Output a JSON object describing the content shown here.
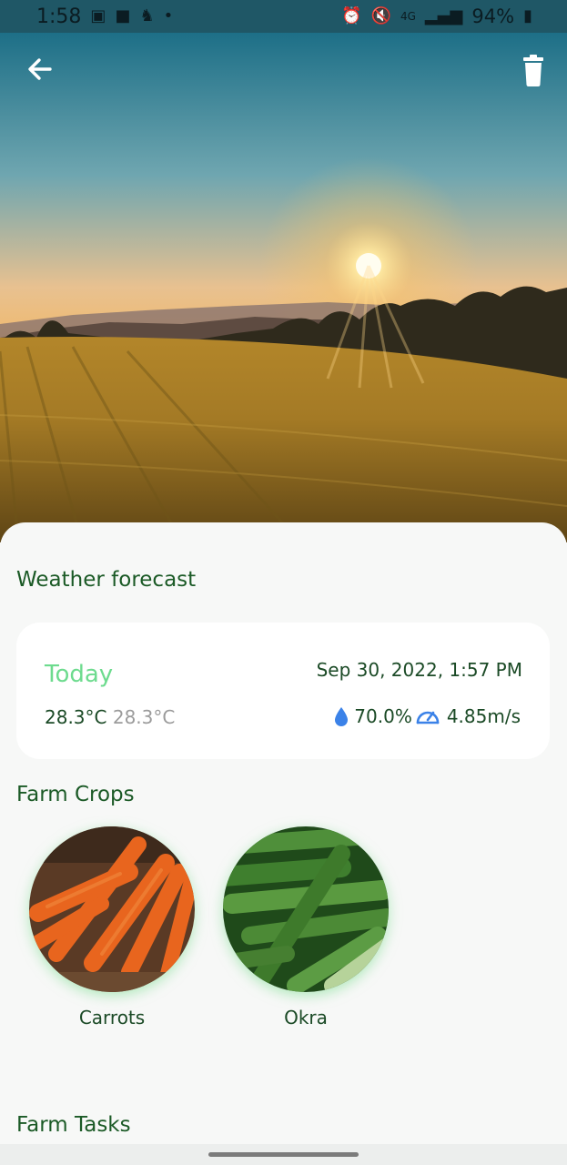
{
  "status_bar": {
    "time": "1:58",
    "left_icons": [
      "gallery-icon",
      "app-icon",
      "app-icon-2",
      "dot-icon"
    ],
    "right_icons": [
      "alarm-icon",
      "mute-icon",
      "network-4g-icon",
      "signal-icon"
    ],
    "battery": "94%"
  },
  "header": {
    "back_icon": "arrow-left-icon",
    "delete_icon": "trash-icon"
  },
  "weather": {
    "section_title": "Weather forecast",
    "day": "Today",
    "datetime": "Sep 30, 2022, 1:57 PM",
    "temp_high": "28.3°C",
    "temp_low": "28.3°C",
    "humidity": "70.0%",
    "wind": "4.85m/s",
    "humidity_icon": "water-drop-icon",
    "wind_icon": "speedometer-icon"
  },
  "crops": {
    "section_title": "Farm Crops",
    "items": [
      {
        "label": "Carrots"
      },
      {
        "label": "Okra"
      }
    ]
  },
  "tasks": {
    "section_title": "Farm Tasks"
  },
  "colors": {
    "accent_green": "#6ddb8e",
    "title_green": "#1b5a26",
    "text_green": "#1b4a26",
    "muted": "#9b9b9b"
  }
}
